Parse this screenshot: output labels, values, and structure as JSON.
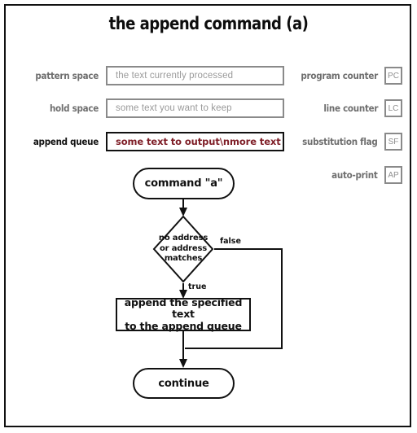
{
  "title": "the append command (a)",
  "state_rows": [
    {
      "label": "pattern space",
      "value": "the text currently processed",
      "active": false
    },
    {
      "label": "hold space",
      "value": "some text you want to keep",
      "active": false
    },
    {
      "label": "append queue",
      "value": "some text to output\\nmore text",
      "active": true
    }
  ],
  "registers": [
    {
      "label": "program counter",
      "abbr": "PC"
    },
    {
      "label": "line counter",
      "abbr": "LC"
    },
    {
      "label": "substitution flag",
      "abbr": "SF"
    },
    {
      "label": "auto-print",
      "abbr": "AP"
    }
  ],
  "flowchart": {
    "start_label": "command \"a\"",
    "decision_line1": "no address",
    "decision_line2": "or address",
    "decision_line3": "matches",
    "branch_false": "false",
    "branch_true": "true",
    "process_line1": "append the specified text",
    "process_line2": "to the append queue",
    "end_label": "continue"
  },
  "colors": {
    "frame": "#111111",
    "muted_label": "#6e6e6e",
    "placeholder": "#9a9a9a",
    "active_value": "#7e1d26",
    "line": "#111111"
  }
}
